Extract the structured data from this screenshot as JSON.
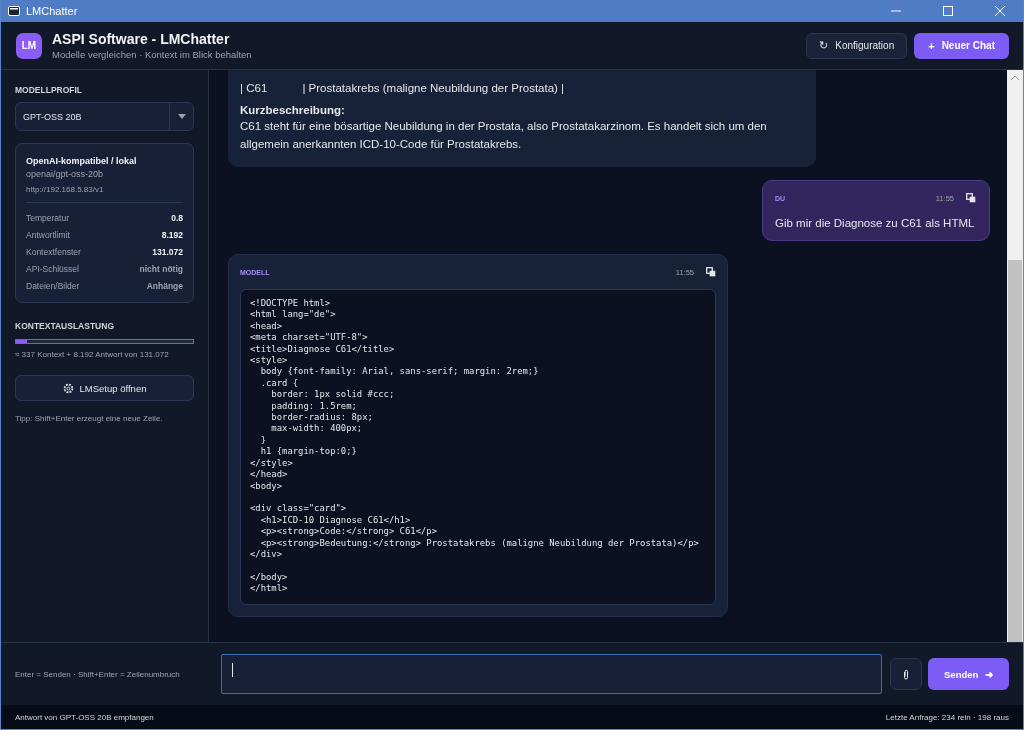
{
  "window": {
    "title": "LMChatter"
  },
  "header": {
    "logo": "LM",
    "title": "ASPI Software - LMChatter",
    "subtitle": "Modelle vergleichen · Kontext im Blick behalten",
    "buttons": [
      {
        "kind": "secondary",
        "icon": "↻",
        "label": "Konfiguration"
      },
      {
        "kind": "primary",
        "icon": "+",
        "label": "Neuer Chat"
      }
    ]
  },
  "sidebar": {
    "profile_label": "MODELLPROFIL",
    "profile_value": "GPT-OSS 20B",
    "card": {
      "title": "OpenAI-kompatibel / lokal",
      "model": "openai/gpt-oss-20b",
      "url": "http://192.168.5.83/v1",
      "rows": [
        {
          "label": "Temperatur",
          "value": "0.8",
          "strong": true
        },
        {
          "label": "Antwortlimit",
          "value": "8.192",
          "strong": true
        },
        {
          "label": "Kontextfenster",
          "value": "131.072",
          "strong": true
        },
        {
          "label": "API-Schlüssel",
          "value": "nicht nötig",
          "strong": false
        },
        {
          "label": "Dateien/Bilder",
          "value": "Anhänge",
          "strong": false
        }
      ]
    },
    "context_label": "KONTEXTAUSLASTUNG",
    "context": {
      "level": 0.06
    },
    "context_text": "≈ 337 Kontext + 8.192 Antwort von 131.072",
    "setup_button": "LMSetup öffnen",
    "tip": "Tipp: Shift+Enter erzeugt eine neue Zeile."
  },
  "messages": [
    {
      "kind": "partial",
      "lines": [
        "| C61           | Prostatakrebs (maligne Neubildung der Prostata) |"
      ],
      "heading": "Kurzbeschreibung:",
      "text": "C61 steht für eine bösartige Neubildung in der Prostata, also Prostatakarzinom. Es handelt sich um den allgemein anerkannten ICD-10-Code für Prostatakrebs."
    },
    {
      "kind": "user",
      "author": "DU",
      "time": "11:55",
      "text": "Gib mir die Diagnose zu C61 als HTML"
    },
    {
      "kind": "code",
      "author": "MODELL",
      "time": "11:55",
      "code": [
        "<!DOCTYPE html>",
        "<html lang=\"de\">",
        "<head>",
        "<meta charset=\"UTF-8\">",
        "<title>Diagnose C61</title>",
        "<style>",
        "  body {font-family: Arial, sans-serif; margin: 2rem;}",
        "  .card {",
        "    border: 1px solid #ccc;",
        "    padding: 1.5rem;",
        "    border-radius: 8px;",
        "    max-width: 400px;",
        "  }",
        "  h1 {margin-top:0;}",
        "</style>",
        "</head>",
        "<body>"
      ],
      "code_2": [
        "<div class=\"card\">",
        "  <h1>ICD-10 Diagnose C61</h1>",
        "  <p><strong>Code:</strong> C61</p>",
        "  <p><strong>Bedeutung:</strong> Prostatakrebs (maligne Neubildung der Prostata)</p>",
        "</div>"
      ],
      "code_3": [
        "</body>",
        "</html>"
      ]
    }
  ],
  "composer": {
    "hint": "Enter = Senden · Shift+Enter = Zeilenumbruch",
    "send": "Senden",
    "send_icon": "➜"
  },
  "status_bar": {
    "left": "Antwort von GPT-OSS 20B empfangen",
    "right": "Letzte Anfrage: 234 rein · 198 raus"
  }
}
